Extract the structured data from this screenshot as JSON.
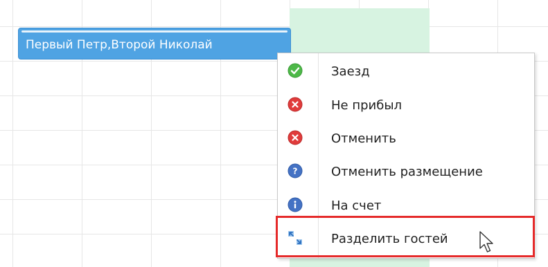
{
  "booking": {
    "label": "Первый Петр,Второй Николай",
    "color": "#4fa3e3"
  },
  "context_menu": {
    "items": [
      {
        "label": "Заезд",
        "icon": "check-circle-icon",
        "color": "#4db848"
      },
      {
        "label": "Не прибыл",
        "icon": "x-circle-icon",
        "color": "#e03b3b"
      },
      {
        "label": "Отменить",
        "icon": "x-circle-icon",
        "color": "#e03b3b"
      },
      {
        "label": "Отменить размещение",
        "icon": "question-circle-icon",
        "color": "#4472c4"
      },
      {
        "label": "На счет",
        "icon": "info-circle-icon",
        "color": "#4472c4"
      },
      {
        "label": "Разделить гостей",
        "icon": "split-arrows-icon",
        "color": "#3a87d8"
      }
    ],
    "highlight_color": "#e52a2a"
  }
}
